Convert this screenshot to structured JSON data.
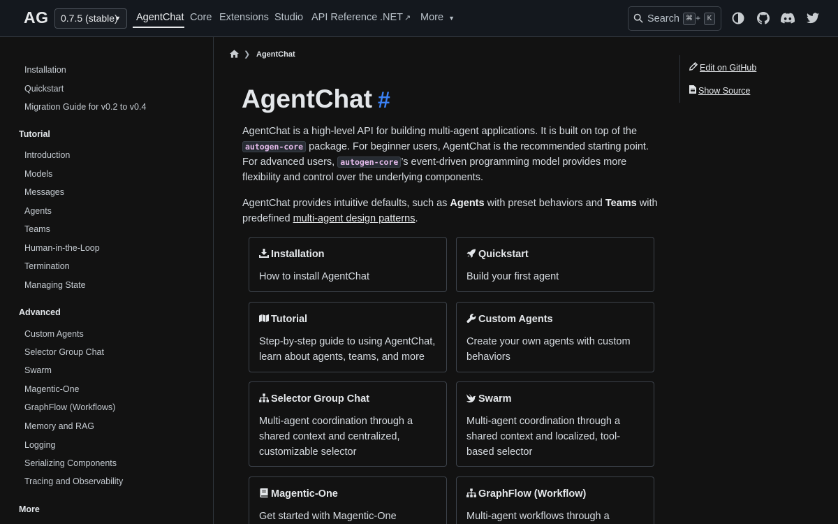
{
  "header": {
    "logo": "AG",
    "version": "0.7.5 (stable)",
    "nav": [
      {
        "label": "AgentChat",
        "active": true
      },
      {
        "label": "Core"
      },
      {
        "label": "Extensions"
      },
      {
        "label": "Studio"
      },
      {
        "label": "API Reference"
      },
      {
        "label": ".NET"
      },
      {
        "label": "More"
      }
    ],
    "search": {
      "label": "Search",
      "key_mod": "⌘",
      "key_plus": "+",
      "key_letter": "K"
    },
    "icons": [
      "theme-toggle-icon",
      "github-icon",
      "discord-icon",
      "twitter-icon"
    ]
  },
  "sidebar": {
    "top_items": [
      "Installation",
      "Quickstart",
      "Migration Guide for v0.2 to v0.4"
    ],
    "tutorial": {
      "heading": "Tutorial",
      "items": [
        "Introduction",
        "Models",
        "Messages",
        "Agents",
        "Teams",
        "Human-in-the-Loop",
        "Termination",
        "Managing State"
      ]
    },
    "advanced": {
      "heading": "Advanced",
      "items": [
        "Custom Agents",
        "Selector Group Chat",
        "Swarm",
        "Magentic-One",
        "GraphFlow (Workflows)",
        "Memory and RAG",
        "Logging",
        "Serializing Components",
        "Tracing and Observability"
      ]
    },
    "more": {
      "heading": "More"
    }
  },
  "breadcrumb": {
    "current": "AgentChat"
  },
  "page": {
    "title": "AgentChat",
    "anchor": "#",
    "intro": {
      "p1_a": "AgentChat is a high-level API for building multi-agent applications. It is built on top of the ",
      "code1": "autogen-core",
      "p1_b": " package. For beginner users, AgentChat is the recommended starting point. For advanced users, ",
      "code2": "autogen-core",
      "p1_c": "’s event-driven programming model provides more flexibility and control over the underlying components."
    },
    "intro2": {
      "a": "AgentChat provides intuitive defaults, such as ",
      "b1": "Agents",
      "c": " with preset behaviors and ",
      "b2": "Teams",
      "d": " with predefined ",
      "link": "multi-agent design patterns",
      "e": "."
    },
    "cards": [
      {
        "title": "Installation",
        "icon": "download-icon",
        "desc": "How to install AgentChat"
      },
      {
        "title": "Quickstart",
        "icon": "rocket-icon",
        "desc": "Build your first agent"
      },
      {
        "title": "Tutorial",
        "icon": "map-icon",
        "desc": "Step-by-step guide to using AgentChat, learn about agents, teams, and more"
      },
      {
        "title": "Custom Agents",
        "icon": "wrench-icon",
        "desc": "Create your own agents with custom behaviors"
      },
      {
        "title": "Selector Group Chat",
        "icon": "sitemap-icon",
        "desc": "Multi-agent coordination through a shared context and centralized, customizable selector"
      },
      {
        "title": "Swarm",
        "icon": "swarm-bird-icon",
        "desc": "Multi-agent coordination through a shared context and localized, tool-based selector"
      },
      {
        "title": "Magentic-One",
        "icon": "book-icon",
        "desc": "Get started with Magentic-One"
      },
      {
        "title": "GraphFlow (Workflow)",
        "icon": "sitemap-icon",
        "desc": "Multi-agent workflows through a directed"
      }
    ]
  },
  "right_toc": {
    "edit": "Edit on GitHub",
    "source": "Show Source"
  }
}
